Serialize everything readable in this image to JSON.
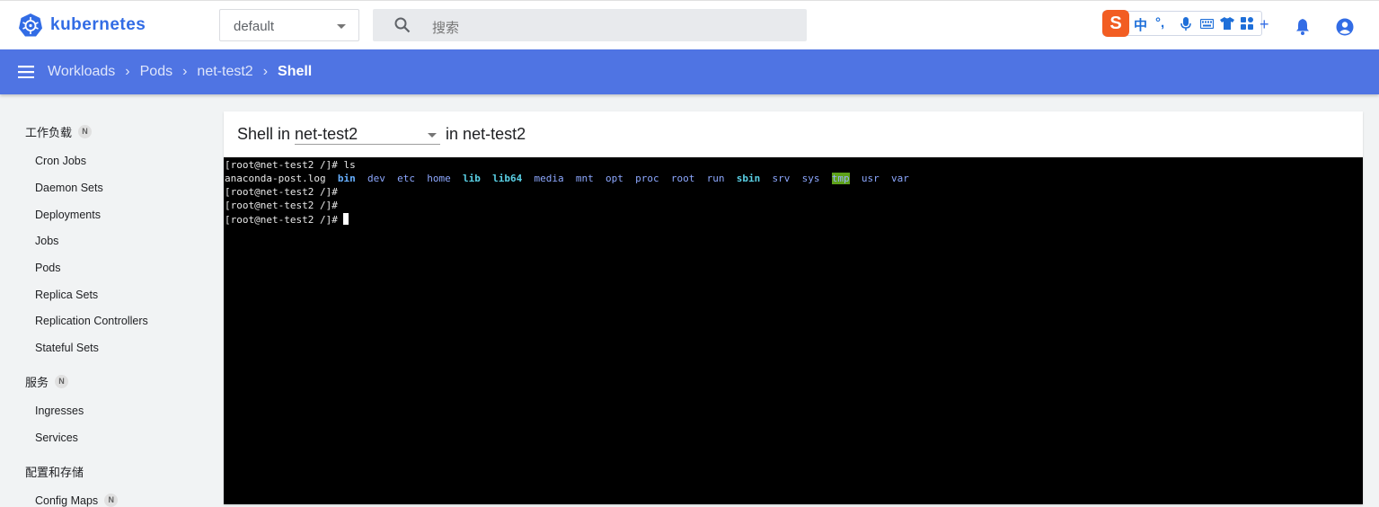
{
  "app": {
    "title": "kubernetes"
  },
  "topbar": {
    "namespace": "default",
    "search_placeholder": "搜索",
    "ime": {
      "logo": "S",
      "mode": "中",
      "punct": "°,"
    }
  },
  "breadcrumbs": [
    "Workloads",
    "Pods",
    "net-test2",
    "Shell"
  ],
  "sidebar": {
    "sections": [
      {
        "label": "工作负载",
        "badge": "N",
        "items": [
          "Cron Jobs",
          "Daemon Sets",
          "Deployments",
          "Jobs",
          "Pods",
          "Replica Sets",
          "Replication Controllers",
          "Stateful Sets"
        ]
      },
      {
        "label": "服务",
        "badge": "N",
        "items": [
          "Ingresses",
          "Services"
        ]
      },
      {
        "label": "配置和存储",
        "items": []
      },
      {
        "label": "",
        "items": [
          "Config Maps"
        ],
        "badge": "N"
      }
    ]
  },
  "shell": {
    "prefix": "Shell in",
    "container": "net-test2",
    "suffix": "in net-test2",
    "terminal": {
      "prompt": "[root@net-test2 /]#",
      "command": " ls",
      "ls_items": [
        "anaconda-post.log",
        "bin",
        "dev",
        "etc",
        "home",
        "lib",
        "lib64",
        "media",
        "mnt",
        "opt",
        "proc",
        "root",
        "run",
        "sbin",
        "srv",
        "sys",
        "tmp",
        "usr",
        "var"
      ]
    }
  }
}
